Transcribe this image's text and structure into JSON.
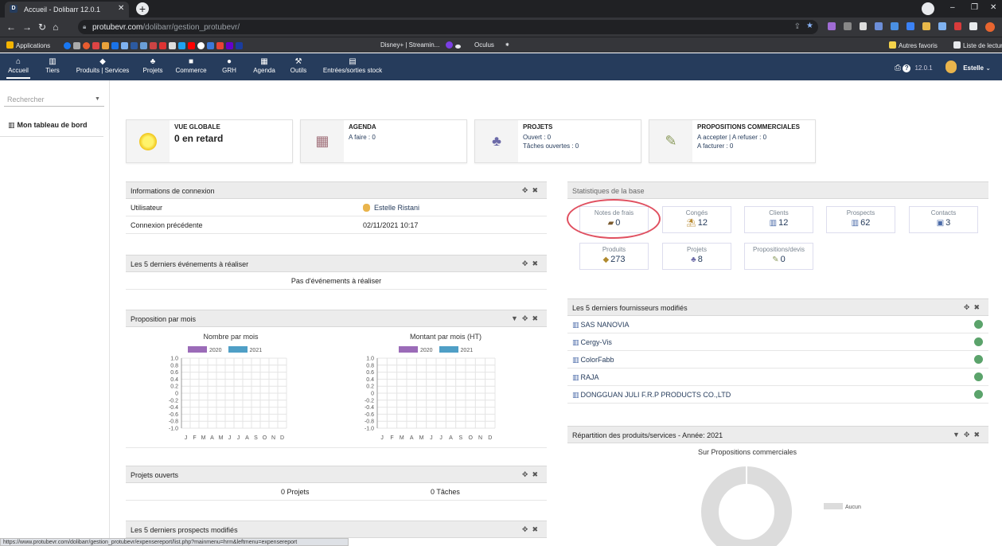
{
  "browser": {
    "tab_title": "Accueil - Dolibarr 12.0.1",
    "tab_favicon": "D",
    "url_host": "protubevr.com",
    "url_path": "/dolibarr/gestion_protubevr/",
    "bookmarks": [
      {
        "label": "Applications",
        "color": "#e8eaed"
      },
      {
        "label": "Disney+ | Streamin...",
        "color": "#1a3d9e"
      },
      {
        "label": "Oculus",
        "color": "#e8eaed"
      }
    ],
    "other_favorites": "Autres favoris",
    "reading_list": "Liste de lecture",
    "status_url": "https://www.protubevr.com/dolibarr/gestion_protubevr/expensereport/list.php?mainmenu=hrm&leftmenu=expensereport"
  },
  "topnav": {
    "items": [
      {
        "label": "Accueil",
        "icon": "home-icon"
      },
      {
        "label": "Tiers",
        "icon": "building-icon"
      },
      {
        "label": "Produits | Services",
        "icon": "cube-icon"
      },
      {
        "label": "Projets",
        "icon": "sitemap-icon"
      },
      {
        "label": "Commerce",
        "icon": "briefcase-icon"
      },
      {
        "label": "GRH",
        "icon": "user-icon"
      },
      {
        "label": "Agenda",
        "icon": "calendar-icon"
      },
      {
        "label": "Outils",
        "icon": "wrench-icon"
      },
      {
        "label": "Entrées/sorties stock",
        "icon": "boxes-icon"
      }
    ],
    "version": "12.0.1",
    "user": "Estelle"
  },
  "left": {
    "search_placeholder": "Rechercher",
    "menu_item": "Mon tableau de bord"
  },
  "summary_boxes": [
    {
      "title": "VUE GLOBALE",
      "lines": [],
      "big": "0 en retard"
    },
    {
      "title": "AGENDA",
      "lines": [
        "A faire : 0"
      ],
      "big": ""
    },
    {
      "title": "PROJETS",
      "lines": [
        "Ouvert : 0",
        "Tâches ouvertes : 0"
      ],
      "big": ""
    },
    {
      "title": "PROPOSITIONS COMMERCIALES",
      "lines": [
        "A accepter | A refuser : 0",
        "A facturer : 0"
      ],
      "big": ""
    }
  ],
  "connexion": {
    "title": "Informations de connexion",
    "rows": [
      {
        "label": "Utilisateur",
        "value": "Estelle Ristani"
      },
      {
        "label": "Connexion précédente",
        "value": "02/11/2021 10:17"
      }
    ]
  },
  "events": {
    "title": "Les 5 derniers événements à réaliser",
    "empty": "Pas d'événements à réaliser"
  },
  "proposition_par_mois": {
    "title": "Proposition par mois",
    "charts": [
      {
        "title": "Nombre par mois"
      },
      {
        "title": "Montant par mois (HT)"
      }
    ]
  },
  "chart_data": [
    {
      "type": "bar",
      "title": "Nombre par mois",
      "categories": [
        "J",
        "F",
        "M",
        "A",
        "M",
        "J",
        "J",
        "A",
        "S",
        "O",
        "N",
        "D"
      ],
      "series": [
        {
          "name": "2020",
          "values": [
            0,
            0,
            0,
            0,
            0,
            0,
            0,
            0,
            0,
            0,
            0,
            0
          ],
          "color": "#9b6bb8"
        },
        {
          "name": "2021",
          "values": [
            0,
            0,
            0,
            0,
            0,
            0,
            0,
            0,
            0,
            0,
            0,
            0
          ],
          "color": "#4f9fc6"
        }
      ],
      "yticks": [
        "1.0",
        "0.8",
        "0.6",
        "0.4",
        "0.2",
        "0",
        "-0.2",
        "-0.4",
        "-0.6",
        "-0.8",
        "-1.0"
      ],
      "ylim": [
        -1,
        1
      ]
    },
    {
      "type": "bar",
      "title": "Montant par mois (HT)",
      "categories": [
        "J",
        "F",
        "M",
        "A",
        "M",
        "J",
        "J",
        "A",
        "S",
        "O",
        "N",
        "D"
      ],
      "series": [
        {
          "name": "2020",
          "values": [
            0,
            0,
            0,
            0,
            0,
            0,
            0,
            0,
            0,
            0,
            0,
            0
          ],
          "color": "#9b6bb8"
        },
        {
          "name": "2021",
          "values": [
            0,
            0,
            0,
            0,
            0,
            0,
            0,
            0,
            0,
            0,
            0,
            0
          ],
          "color": "#4f9fc6"
        }
      ],
      "yticks": [
        "1.0",
        "0.8",
        "0.6",
        "0.4",
        "0.2",
        "0",
        "-0.2",
        "-0.4",
        "-0.6",
        "-0.8",
        "-1.0"
      ],
      "ylim": [
        -1,
        1
      ]
    },
    {
      "type": "pie",
      "title": "Sur Propositions commerciales",
      "categories": [
        "Aucun"
      ],
      "values": [
        1
      ],
      "color": "#dcdcdc"
    }
  ],
  "projets_ouverts": {
    "title": "Projets ouverts",
    "projets": "0 Projets",
    "taches": "0 Tâches"
  },
  "prospects": {
    "title": "Les 5 derniers prospects modifiés"
  },
  "stats": {
    "title": "Statistiques de la base",
    "tiles": [
      {
        "label": "Notes de frais",
        "value": "0",
        "icon": "wallet-icon"
      },
      {
        "label": "Congés",
        "value": "12",
        "icon": "beach-icon"
      },
      {
        "label": "Clients",
        "value": "12",
        "icon": "building-icon"
      },
      {
        "label": "Prospects",
        "value": "62",
        "icon": "building-icon"
      },
      {
        "label": "Contacts",
        "value": "3",
        "icon": "contact-icon"
      },
      {
        "label": "Produits",
        "value": "273",
        "icon": "cube-icon"
      },
      {
        "label": "Projets",
        "value": "8",
        "icon": "sitemap-icon"
      },
      {
        "label": "Propositions/devis",
        "value": "0",
        "icon": "proposal-icon"
      }
    ]
  },
  "fournisseurs": {
    "title": "Les 5 derniers fournisseurs modifiés",
    "rows": [
      "SAS NANOVIA",
      "Cergy-Vis",
      "ColorFabb",
      "RAJA",
      "DONGGUAN JULI F.R.P PRODUCTS CO.,LTD"
    ]
  },
  "repartition": {
    "title": "Répartition des produits/services - Année: 2021",
    "chart_title": "Sur Propositions commerciales",
    "legend": "Aucun"
  }
}
